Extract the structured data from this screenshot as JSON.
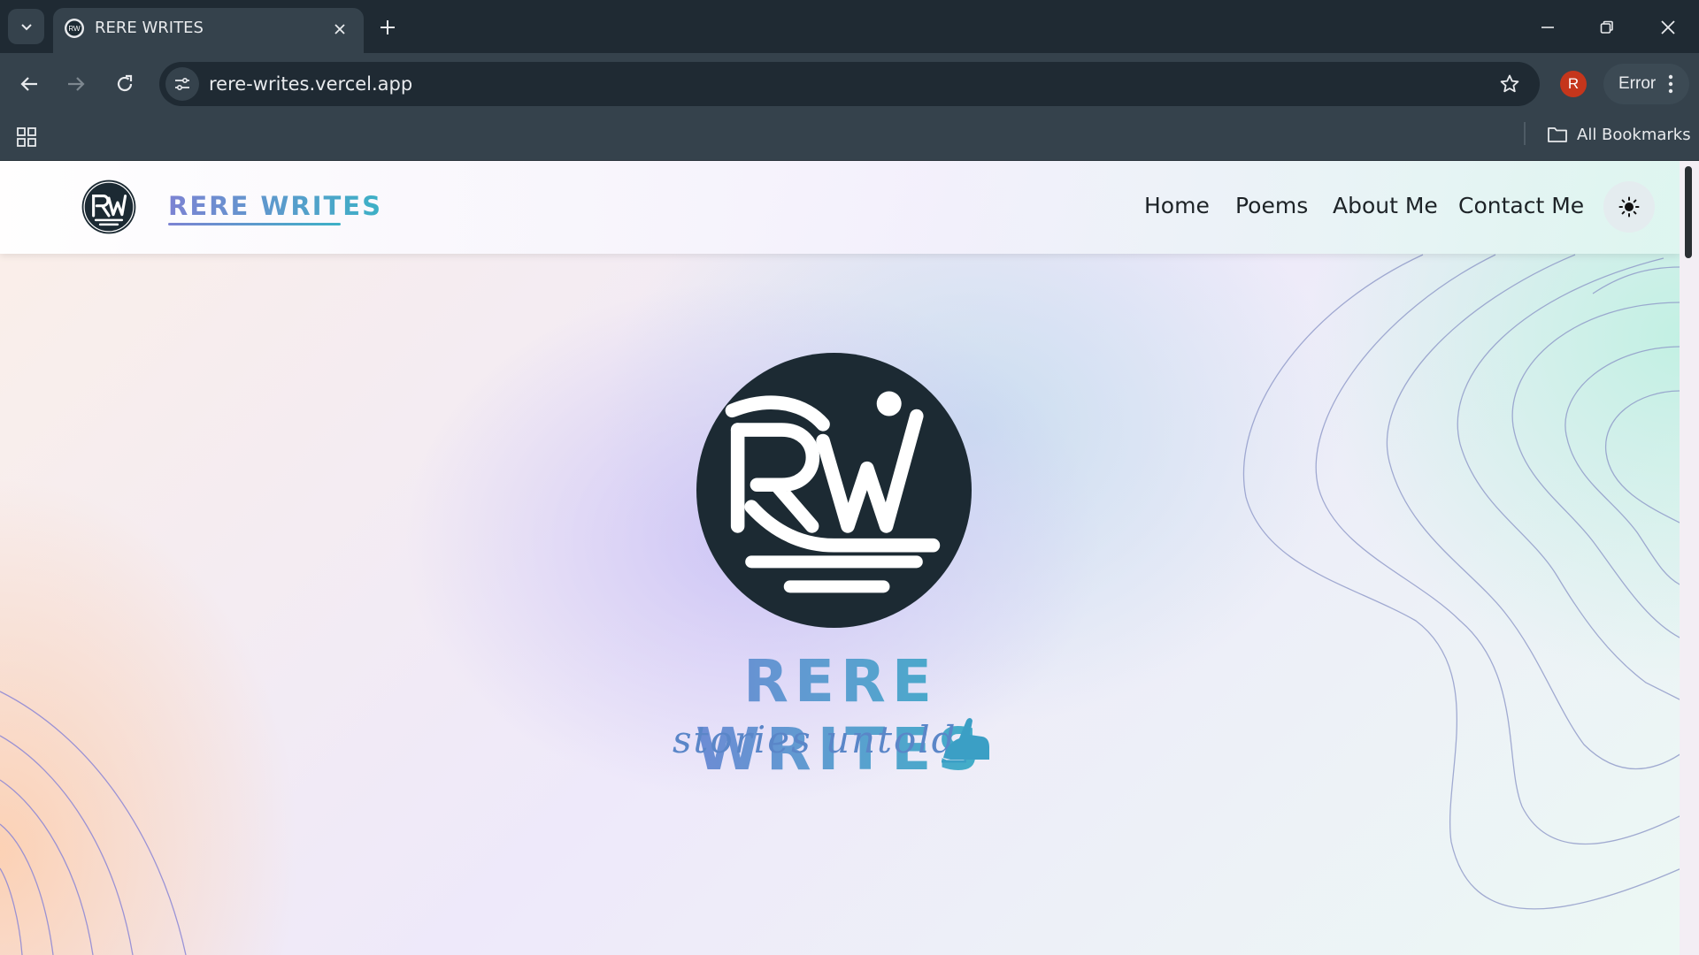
{
  "browser": {
    "tab_title": "RERE WRITES",
    "url": "rere-writes.vercel.app",
    "profile_initial": "R",
    "error_label": "Error",
    "all_bookmarks_label": "All Bookmarks"
  },
  "site": {
    "brand": "RERE WRITES",
    "nav": {
      "home": "Home",
      "poems": "Poems",
      "about": "About Me",
      "contact": "Contact Me"
    },
    "hero": {
      "logo_letters": "RW",
      "title": "RERE WRITES",
      "tagline": "stories untold"
    },
    "colors": {
      "brand_gradient_start": "#7c83d3",
      "brand_gradient_end": "#3cb1c6",
      "logo_circle": "#1c2a33"
    }
  }
}
